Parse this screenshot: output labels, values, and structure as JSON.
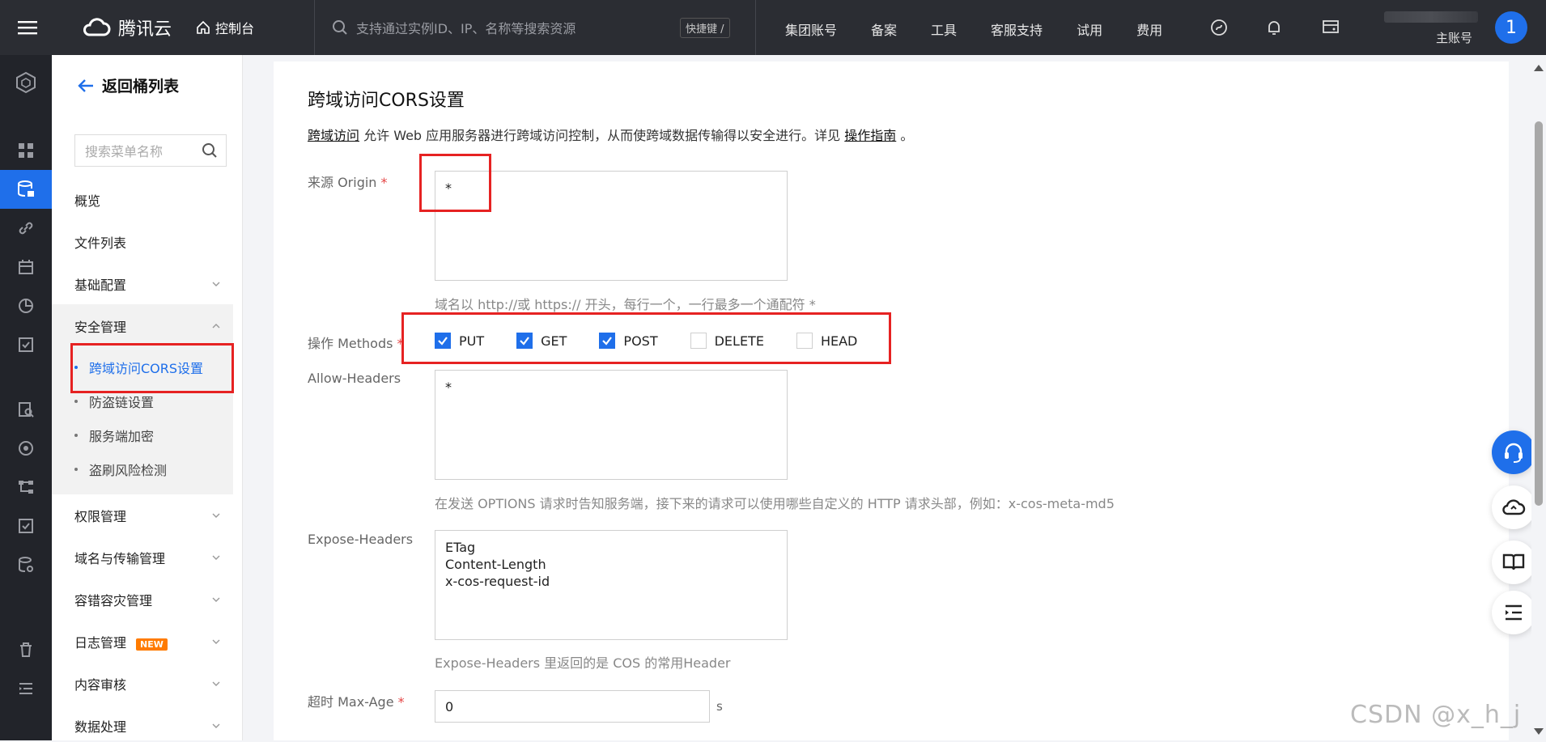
{
  "topbar": {
    "brand": "腾讯云",
    "console": "控制台",
    "search_placeholder": "支持通过实例ID、IP、名称等搜索资源",
    "shortcut": "快捷键 /",
    "nav": [
      "集团账号",
      "备案",
      "工具",
      "客服支持",
      "试用",
      "费用"
    ],
    "account_id_suffix": "7",
    "account_label": "主账号",
    "avatar": "1"
  },
  "menu": {
    "back": "返回桶列表",
    "search_placeholder": "搜索菜单名称",
    "items": {
      "overview": "概览",
      "files": "文件列表",
      "basic": "基础配置",
      "security": "安全管理",
      "permissions": "权限管理",
      "domains": "域名与传输管理",
      "dr": "容错容灾管理",
      "logs": "日志管理",
      "logs_badge": "NEW",
      "audit": "内容审核",
      "data": "数据处理"
    },
    "security_sub": [
      "跨域访问CORS设置",
      "防盗链设置",
      "服务端加密",
      "盗刷风险检测"
    ]
  },
  "content": {
    "title": "跨域访问CORS设置",
    "desc_link": "跨域访问",
    "desc_text": " 允许 Web 应用服务器进行跨域访问控制，从而使跨域数据传输得以安全进行。详见 ",
    "desc_guide": "操作指南",
    "desc_end": " 。",
    "origin_label": "来源 Origin",
    "origin_value": "*",
    "origin_hint": "域名以 http://或 https:// 开头，每行一个，一行最多一个通配符 *",
    "methods_label": "操作 Methods",
    "methods": [
      {
        "label": "PUT",
        "checked": true
      },
      {
        "label": "GET",
        "checked": true
      },
      {
        "label": "POST",
        "checked": true
      },
      {
        "label": "DELETE",
        "checked": false
      },
      {
        "label": "HEAD",
        "checked": false
      }
    ],
    "allow_headers_label": "Allow-Headers",
    "allow_headers_value": "*",
    "allow_headers_hint": "在发送 OPTIONS 请求时告知服务端，接下来的请求可以使用哪些自定义的 HTTP 请求头部，例如：x-cos-meta-md5",
    "expose_headers_label": "Expose-Headers",
    "expose_headers_value": "ETag\nContent-Length\nx-cos-request-id",
    "expose_headers_hint": "Expose-Headers 里返回的是 COS 的常用Header",
    "max_age_label": "超时 Max-Age",
    "max_age_value": "0",
    "max_age_unit": "s",
    "required_mark": "*"
  },
  "watermark": "CSDN @x_h_j",
  "colors": {
    "accent": "#1f6fea",
    "highlight_box": "#e62222",
    "badge": "#ff7b00"
  }
}
